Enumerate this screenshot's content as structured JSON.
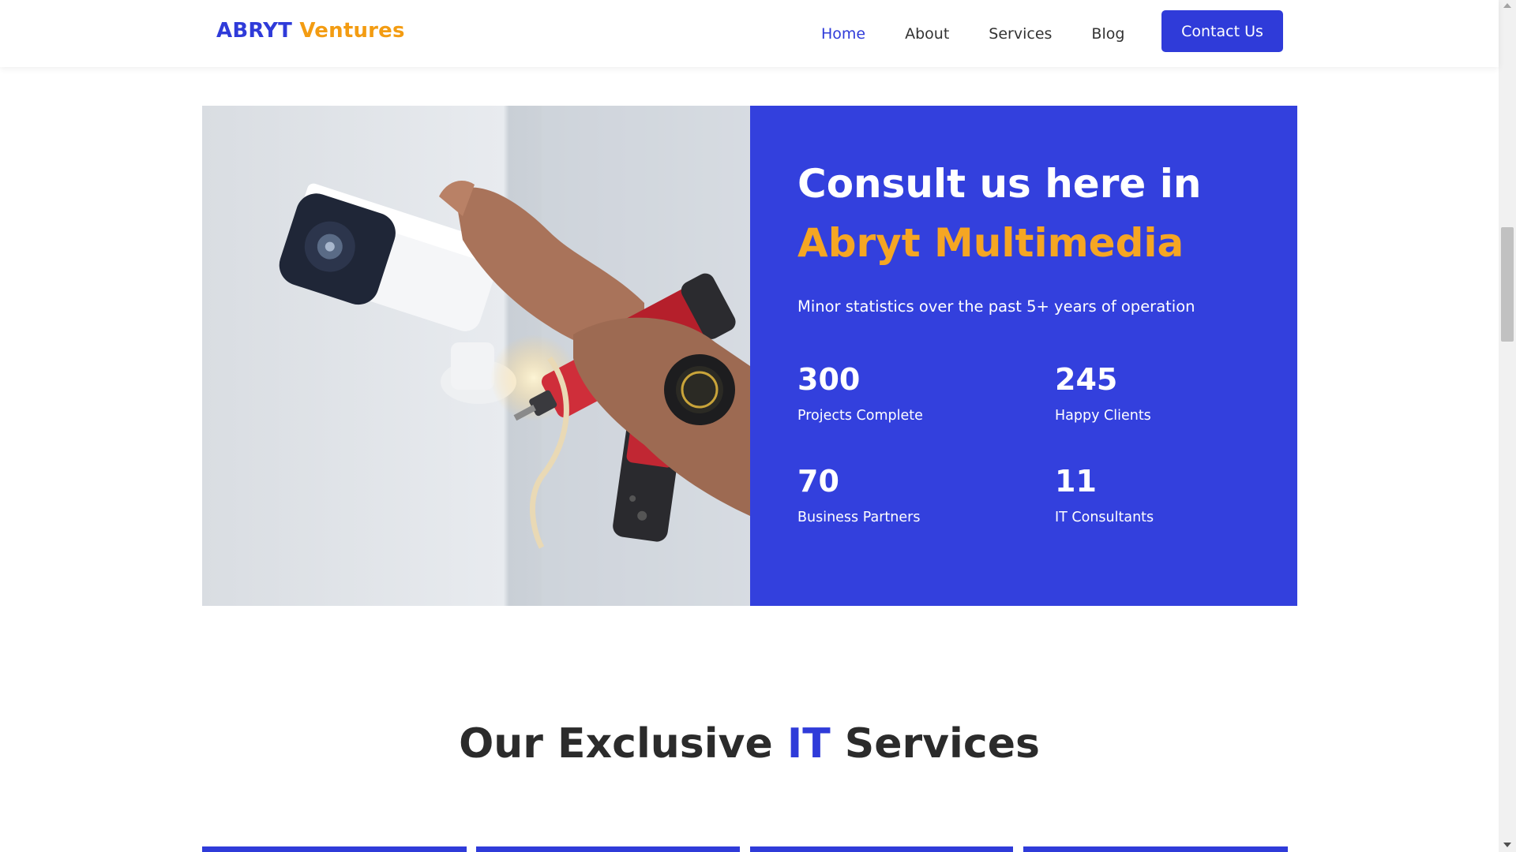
{
  "brand": {
    "part1": "ABRYT",
    "part2": "Ventures"
  },
  "nav": {
    "items": [
      {
        "label": "Home",
        "active": true
      },
      {
        "label": "About",
        "active": false
      },
      {
        "label": "Services",
        "active": false
      },
      {
        "label": "Blog",
        "active": false
      }
    ],
    "cta_label": "Contact Us"
  },
  "hero": {
    "title_line1": "Consult us here in",
    "title_line2": "Abryt Multimedia",
    "subtitle": "Minor statistics over the past 5+ years of operation",
    "stats": [
      {
        "value": "300",
        "label": "Projects Complete"
      },
      {
        "value": "245",
        "label": "Happy Clients"
      },
      {
        "value": "70",
        "label": "Business Partners"
      },
      {
        "value": "11",
        "label": "IT Consultants"
      }
    ]
  },
  "services": {
    "title_before": "Our Exclusive",
    "title_accent": "IT",
    "title_after": "Services"
  },
  "colors": {
    "primary": "#3340dd",
    "accent": "#f5a623",
    "text_dark": "#2b2b2b"
  }
}
